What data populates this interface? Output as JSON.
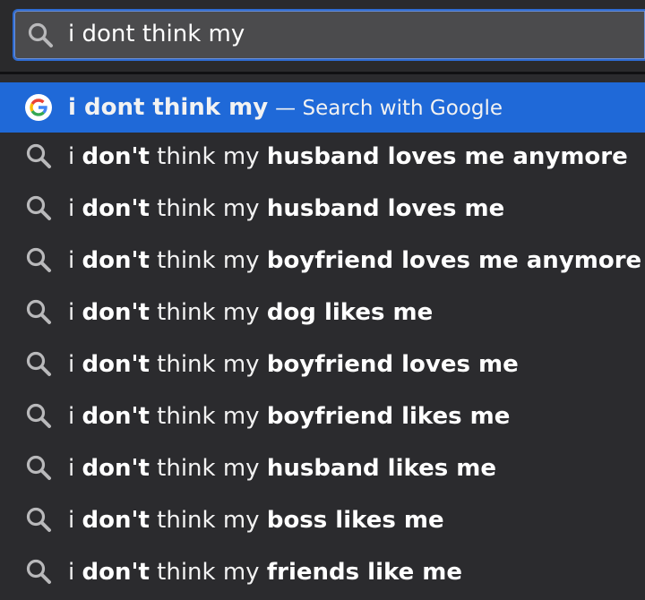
{
  "search": {
    "value": "i dont think my",
    "icon": "search-icon"
  },
  "top_suggestion": {
    "query": "i dont think my",
    "suffix": "— Search with Google",
    "icon": "google-icon",
    "highlight_color": "#1f69d8"
  },
  "suggestions": [
    {
      "prefix": "i ",
      "bold1": "don't",
      "mid": " think my ",
      "bold2": "husband loves me anymore"
    },
    {
      "prefix": "i ",
      "bold1": "don't",
      "mid": " think my ",
      "bold2": "husband loves me"
    },
    {
      "prefix": "i ",
      "bold1": "don't",
      "mid": " think my ",
      "bold2": "boyfriend loves me anymore"
    },
    {
      "prefix": "i ",
      "bold1": "don't",
      "mid": " think my ",
      "bold2": "dog likes me"
    },
    {
      "prefix": "i ",
      "bold1": "don't",
      "mid": " think my ",
      "bold2": "boyfriend loves me"
    },
    {
      "prefix": "i ",
      "bold1": "don't",
      "mid": " think my ",
      "bold2": "boyfriend likes me"
    },
    {
      "prefix": "i ",
      "bold1": "don't",
      "mid": " think my ",
      "bold2": "husband likes me"
    },
    {
      "prefix": "i ",
      "bold1": "don't",
      "mid": " think my ",
      "bold2": "boss likes me"
    },
    {
      "prefix": "i ",
      "bold1": "don't",
      "mid": " think my ",
      "bold2": "friends like me"
    }
  ]
}
